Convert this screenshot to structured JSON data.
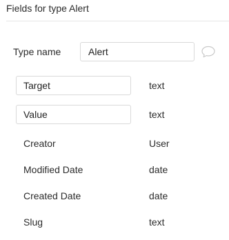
{
  "header": {
    "title": "Fields for type Alert"
  },
  "type_name": {
    "label": "Type name",
    "value": "Alert",
    "comment_icon": "speech-bubble-icon"
  },
  "fields": [
    {
      "name": "Target",
      "type": "text",
      "editable": true
    },
    {
      "name": "Value",
      "type": "text",
      "editable": true
    },
    {
      "name": "Creator",
      "type": "User",
      "editable": false
    },
    {
      "name": "Modified Date",
      "type": "date",
      "editable": false
    },
    {
      "name": "Created Date",
      "type": "date",
      "editable": false
    },
    {
      "name": "Slug",
      "type": "text",
      "editable": false
    }
  ],
  "colors": {
    "text": "#2b2b2b",
    "border": "#d9d9d9",
    "divider": "#e6e6e6",
    "icon": "#c9c9c9"
  }
}
